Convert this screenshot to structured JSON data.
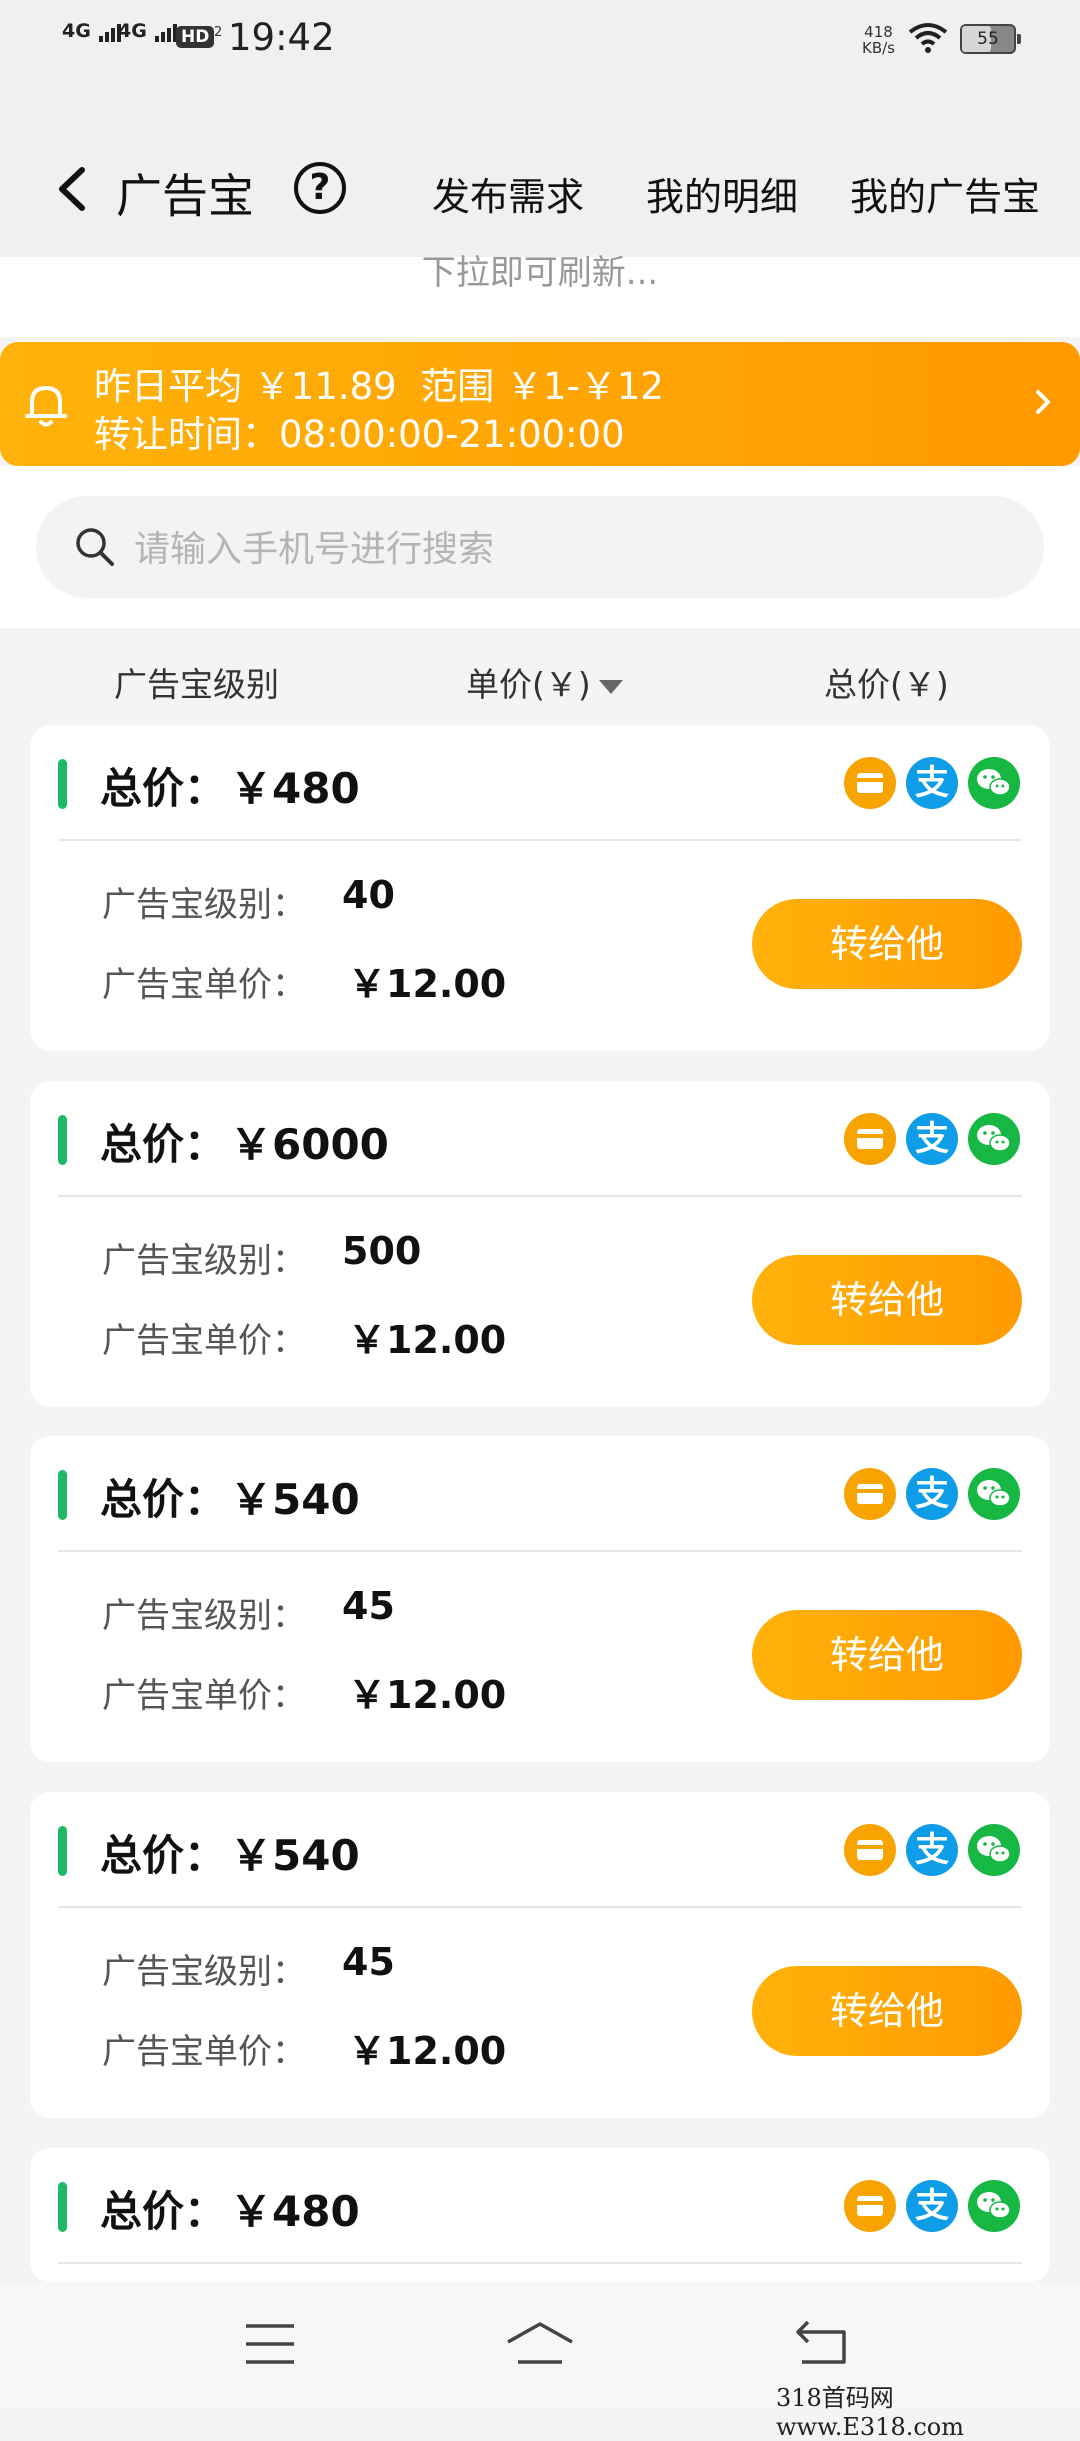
{
  "status_bar": {
    "sim1": "4G",
    "sim2": "4G",
    "hd": "HD",
    "hd_sub": "2",
    "time": "19:42",
    "net_speed_value": "418",
    "net_speed_unit": "KB/s",
    "battery": "55",
    "battery_level_percent": 55
  },
  "header": {
    "title": "广告宝",
    "help_symbol": "?",
    "nav": [
      "发布需求",
      "我的明细",
      "我的广告宝"
    ]
  },
  "refresh_hint": "下拉即可刷新...",
  "banner": {
    "line1": "昨日平均 ￥11.89  范围 ￥1-￥12",
    "line2": "转让时间：08:00:00-21:00:00",
    "colors": {
      "start": "#ffb20a",
      "end": "#ff9a00"
    }
  },
  "search": {
    "placeholder": "请输入手机号进行搜索"
  },
  "columns": [
    "广告宝级别",
    "单价(￥)",
    "总价(￥)"
  ],
  "labels": {
    "total": "总价：",
    "level": "广告宝级别：",
    "unit_price": "广告宝单价：",
    "transfer_button": "转给他"
  },
  "payment_icons": [
    "bank-card-icon",
    "alipay-icon",
    "wechat-pay-icon"
  ],
  "alipay_char": "支",
  "listings": [
    {
      "total": "￥480",
      "level": "40",
      "unit_price": "￥12.00"
    },
    {
      "total": "￥6000",
      "level": "500",
      "unit_price": "￥12.00"
    },
    {
      "total": "￥540",
      "level": "45",
      "unit_price": "￥12.00"
    },
    {
      "total": "￥540",
      "level": "45",
      "unit_price": "￥12.00"
    },
    {
      "total": "￥480"
    }
  ],
  "bottom_nav": [
    "menu-icon",
    "home-icon",
    "back-icon"
  ],
  "watermark": "318首码网 www.E318.com",
  "colors": {
    "accent_green": "#1db964",
    "accent_orange": "#ff9a00"
  }
}
